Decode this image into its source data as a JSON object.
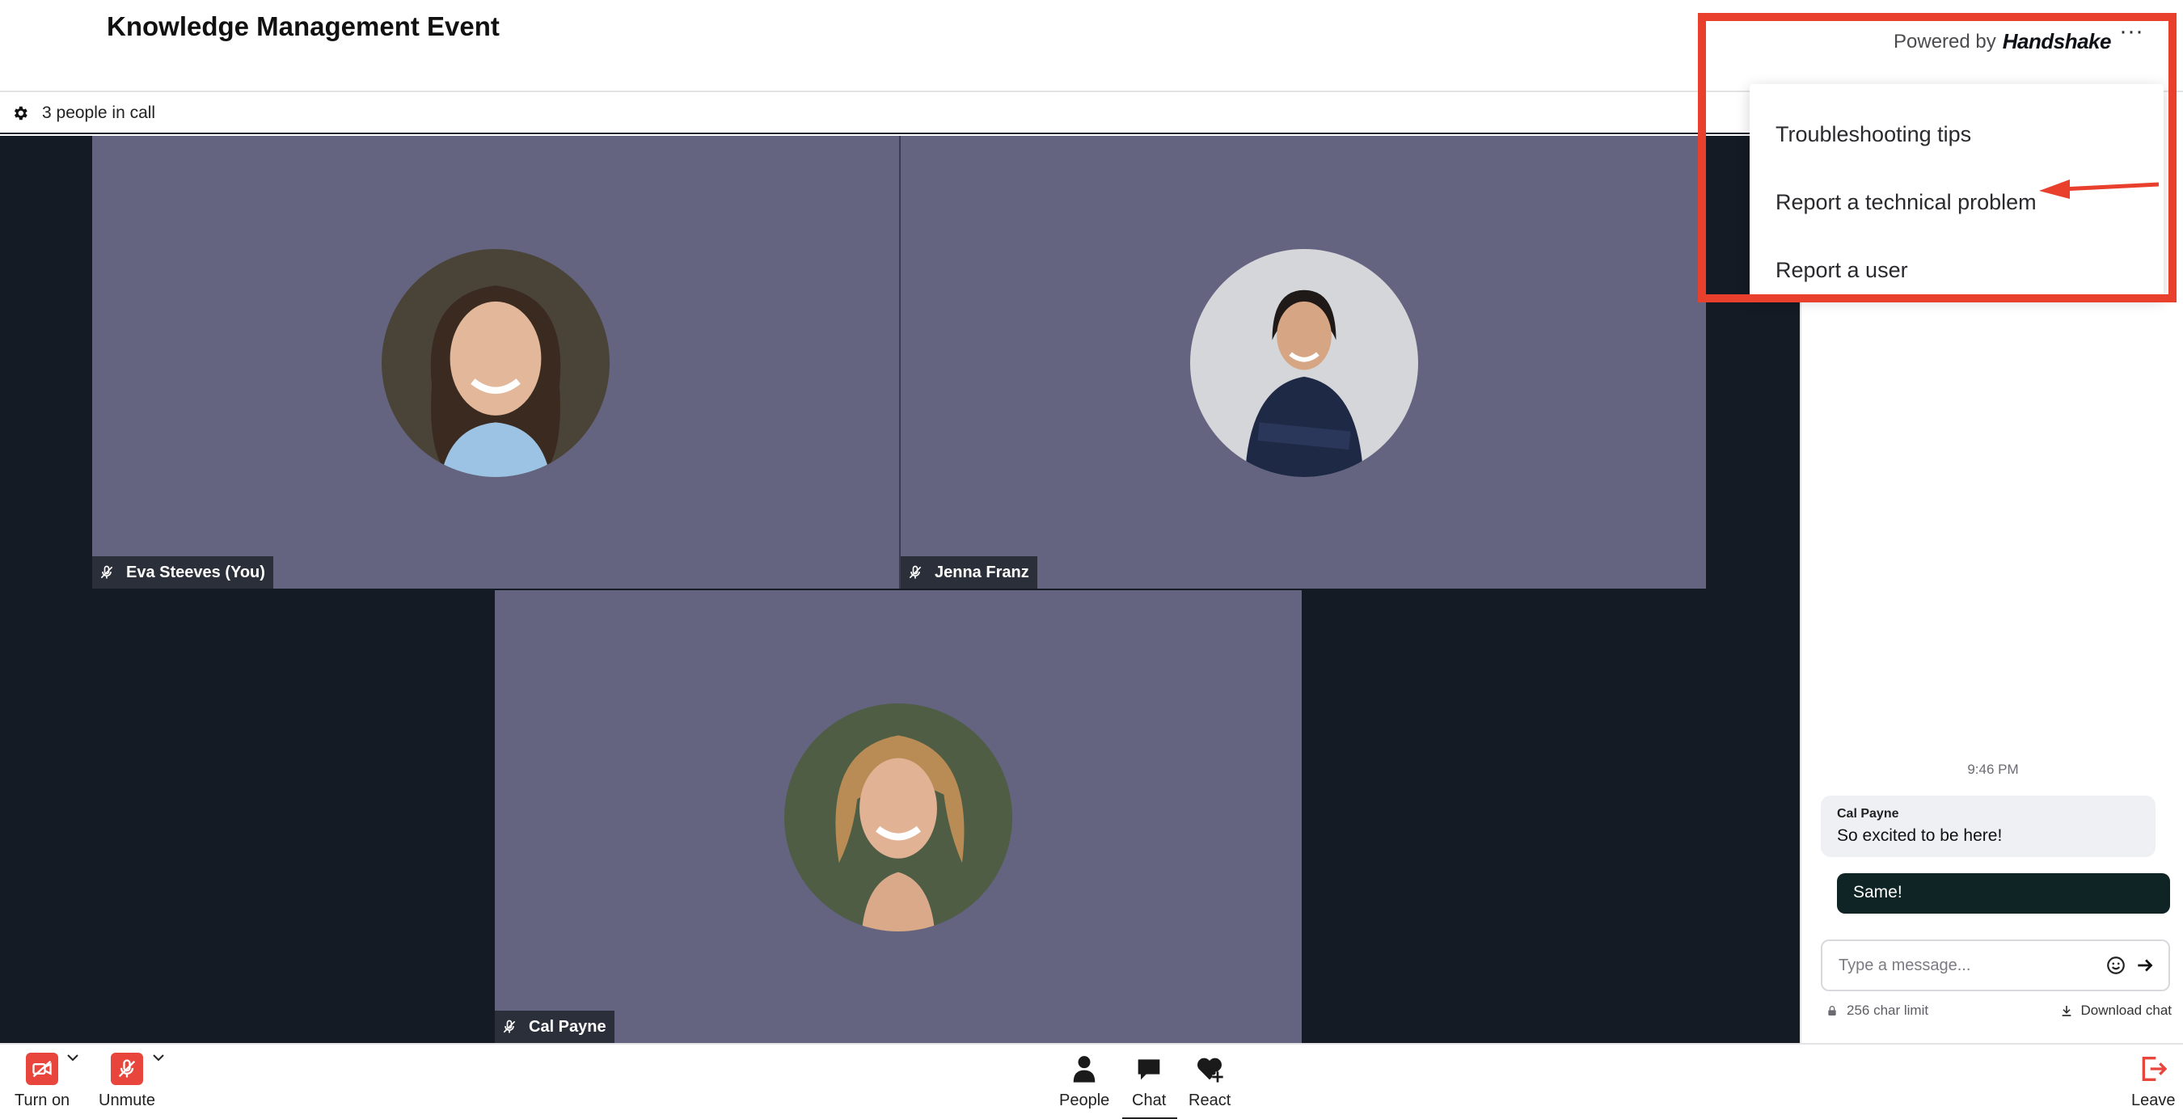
{
  "header": {
    "event_title": "Knowledge Management Event",
    "powered_prefix": "Powered by",
    "powered_brand": "Handshake",
    "more_label": "···"
  },
  "status": {
    "people_in_call": "3 people in call"
  },
  "participants": [
    {
      "name": "Eva Steeves (You)",
      "muted": true
    },
    {
      "name": "Jenna Franz",
      "muted": true
    },
    {
      "name": "Cal Payne",
      "muted": true
    }
  ],
  "menu": {
    "items": [
      {
        "label": "Troubleshooting tips"
      },
      {
        "label": "Report a technical problem"
      },
      {
        "label": "Report a user"
      }
    ]
  },
  "chat": {
    "time": "9:46 PM",
    "messages": [
      {
        "sender": "Cal Payne",
        "text": "So excited to be here!"
      },
      {
        "sender": "",
        "text": "Same!"
      }
    ],
    "input_placeholder": "Type a message...",
    "char_limit": "256 char limit",
    "download_label": "Download chat"
  },
  "toolbar": {
    "camera_label": "Turn on",
    "mic_label": "Unmute",
    "people_label": "People",
    "chat_label": "Chat",
    "react_label": "React",
    "leave_label": "Leave"
  },
  "colors": {
    "accent_red": "#e8453c",
    "annotation_red": "#e8402c",
    "tile_bg": "#646480",
    "stage_bg": "#141b24",
    "outgoing_bubble": "#0f2424"
  },
  "icons": [
    "gear-icon",
    "mic-off-icon",
    "camera-off-icon",
    "person-icon",
    "chat-bubble-icon",
    "heart-plus-icon",
    "leave-icon",
    "emoji-icon",
    "send-arrow-icon",
    "lock-icon",
    "download-icon",
    "chevron-down-icon"
  ]
}
